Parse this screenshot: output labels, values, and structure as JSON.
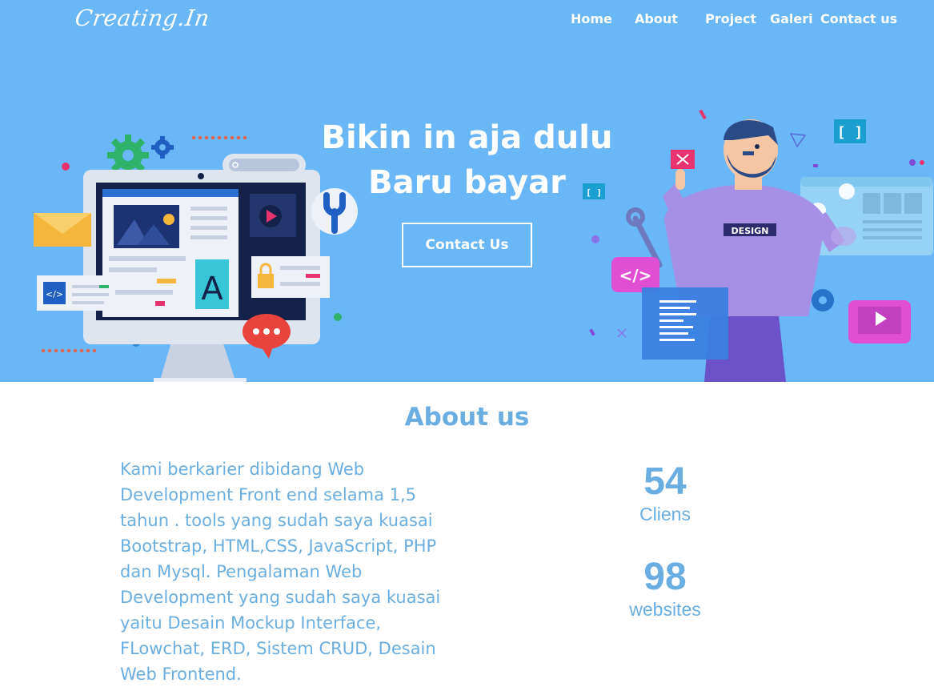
{
  "brand": {
    "logo_text": "Creating.In"
  },
  "nav": {
    "home": "Home",
    "about": "About",
    "project": "Project",
    "galeri": "Galeri",
    "contact": "Contact us"
  },
  "hero": {
    "headline_line1": "Bikin in aja dulu",
    "headline_line2": "Baru bayar",
    "cta_label": "Contact Us",
    "right_illustration_shirt_text": "DESIGN"
  },
  "about": {
    "title": "About us",
    "text": "Kami berkarier dibidang Web Development Front end selama 1,5 tahun . tools yang sudah saya kuasai Bootstrap, HTML,CSS, JavaScript, PHP dan Mysql. Pengalaman Web Development yang sudah saya kuasai yaitu Desain Mockup Interface, FLowchat, ERD, Sistem CRUD, Desain Web Frontend.",
    "stats": [
      {
        "value": "54",
        "label": "Cliens"
      },
      {
        "value": "98",
        "label": "websites"
      }
    ]
  },
  "colors": {
    "hero_bg": "#69b7f6",
    "text_accent": "#6aaee1",
    "white": "#ffffff"
  }
}
